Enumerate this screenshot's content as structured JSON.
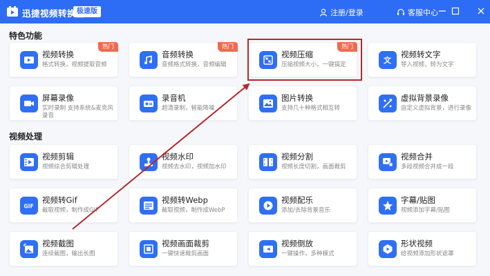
{
  "app": {
    "title": "迅捷视频转换器",
    "edition": "极速版",
    "login": "注册/登录",
    "service": "客服中心",
    "accent": "#2d6cf4",
    "hot_color": "#f06a4d",
    "highlight_color": "#b5282b"
  },
  "sections": [
    {
      "title": "特色功能"
    },
    {
      "title": "视频处理"
    }
  ],
  "cards": [
    {
      "title": "视频转换",
      "desc": "格式转换，视频提取音频",
      "badge": "热门",
      "icon": "video-convert-icon"
    },
    {
      "title": "音频转换",
      "desc": "音频格式转换，音频编辑",
      "badge": "热门",
      "icon": "audio-convert-icon"
    },
    {
      "title": "视频压缩",
      "desc": "压缩视频大小，一键搞定",
      "badge": "热门",
      "icon": "video-compress-icon"
    },
    {
      "title": "视频转文字",
      "desc": "导入视频，转为文字",
      "badge": "",
      "icon": "video-to-text-icon"
    },
    {
      "title": "屏幕录像",
      "desc": "实时录制 支持系统&麦克风录音",
      "badge": "",
      "icon": "screen-record-icon"
    },
    {
      "title": "录音机",
      "desc": "超清录制，智能降噪",
      "badge": "",
      "icon": "recorder-icon"
    },
    {
      "title": "图片转换",
      "desc": "支持几十种格式相互转",
      "badge": "",
      "icon": "image-convert-icon"
    },
    {
      "title": "虚拟背景录像",
      "desc": "自定义虚拟背景，进行录像",
      "badge": "",
      "icon": "virtual-bg-icon"
    },
    {
      "title": "视频剪辑",
      "desc": "视频综合剪辑处理",
      "badge": "",
      "icon": "video-edit-icon"
    },
    {
      "title": "视频水印",
      "desc": "视频去水印，视频加水印",
      "badge": "",
      "icon": "watermark-icon"
    },
    {
      "title": "视频分割",
      "desc": "视频长度切割，画面裁剪",
      "badge": "",
      "icon": "video-split-icon"
    },
    {
      "title": "视频合并",
      "desc": "多段视频合并成一段",
      "badge": "",
      "icon": "video-merge-icon"
    },
    {
      "title": "视频转Gif",
      "desc": "截取视频，制作成GIF",
      "badge": "",
      "icon": "gif-icon"
    },
    {
      "title": "视频转Webp",
      "desc": "截取视频，制作成WebP",
      "badge": "",
      "icon": "webp-icon"
    },
    {
      "title": "视频配乐",
      "desc": "添加/去除背景音乐",
      "badge": "",
      "icon": "music-icon"
    },
    {
      "title": "字幕/贴图",
      "desc": "视频添加字幕/贴图",
      "badge": "",
      "icon": "subtitle-icon"
    },
    {
      "title": "视频截图",
      "desc": "连续截图，输出长图",
      "badge": "",
      "icon": "screenshot-icon"
    },
    {
      "title": "视频画面裁剪",
      "desc": "一键快速裁剪画面",
      "badge": "",
      "icon": "crop-icon"
    },
    {
      "title": "视频倒放",
      "desc": "一键操作，多种模式",
      "badge": "",
      "icon": "reverse-icon"
    },
    {
      "title": "形状视频",
      "desc": "给视频添加形状遮罩",
      "badge": "",
      "icon": "shape-icon"
    }
  ]
}
